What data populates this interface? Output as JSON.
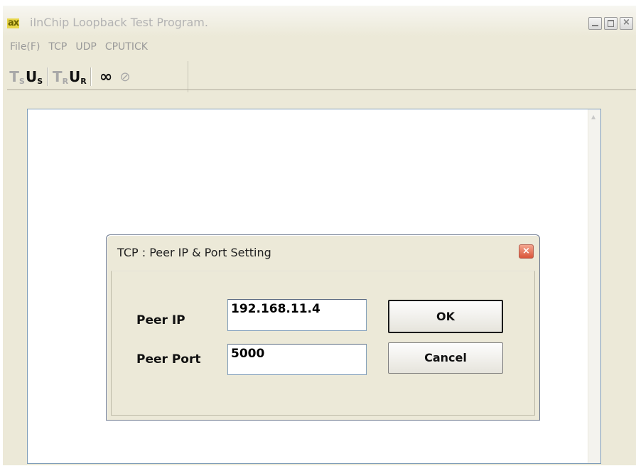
{
  "window": {
    "title": "iInChip Loopback Test Program.",
    "app_icon_text": "ax",
    "controls": {
      "minimize_icon": "minimize-icon",
      "maximize_icon": "maximize-icon",
      "close_icon": "close-icon"
    }
  },
  "menu": {
    "items": [
      {
        "label": "File(F)"
      },
      {
        "label": "TCP"
      },
      {
        "label": "UDP"
      },
      {
        "label": "CPUTICK"
      }
    ]
  },
  "toolbar": {
    "buttons": [
      {
        "main": "T",
        "sub": "S",
        "enabled": false
      },
      {
        "main": "U",
        "sub": "S",
        "enabled": true
      },
      {
        "main": "T",
        "sub": "R",
        "enabled": false
      },
      {
        "main": "U",
        "sub": "R",
        "enabled": true
      },
      {
        "glyph": "∞",
        "enabled": true
      },
      {
        "glyph": "⊘",
        "enabled": false
      }
    ]
  },
  "dialog": {
    "title": "TCP : Peer IP & Port Setting",
    "close_glyph": "×",
    "peer_ip_label": "Peer IP",
    "peer_ip_value": "192.168.11.4",
    "peer_port_label": "Peer Port",
    "peer_port_value": "5000",
    "ok_label": "OK",
    "cancel_label": "Cancel"
  },
  "colors": {
    "window_bg": "#ece9d8",
    "disabled_text": "#a8a8a8",
    "close_button": "#d9553a"
  }
}
